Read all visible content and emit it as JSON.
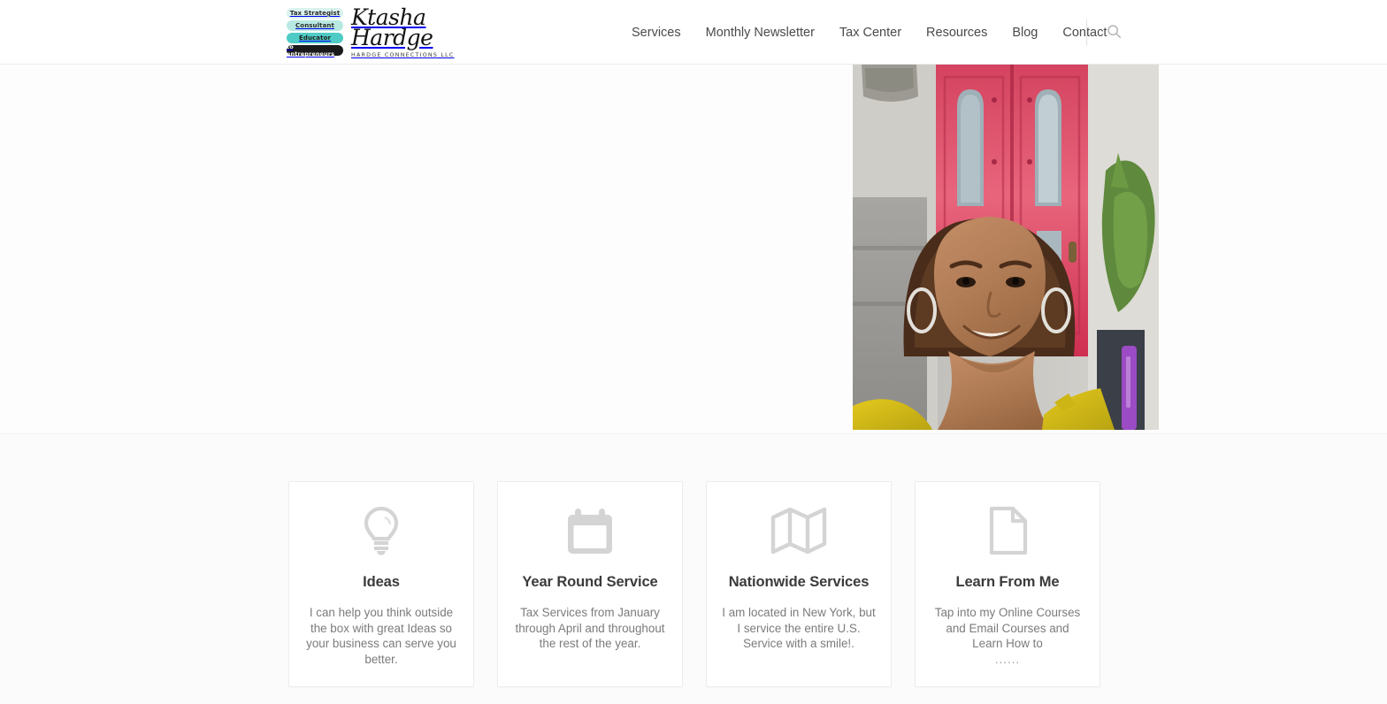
{
  "header": {
    "logo": {
      "badges": [
        "Tax Strategist",
        "Consultant",
        "Educator",
        "to entrepreneurs"
      ],
      "script_line1": "Ktasha",
      "script_line2": "Hardge",
      "subtitle": "HARDGE CONNECTIONS LLC"
    },
    "nav": [
      {
        "label": "Services"
      },
      {
        "label": "Monthly Newsletter"
      },
      {
        "label": "Tax Center"
      },
      {
        "label": "Resources"
      },
      {
        "label": "Blog"
      },
      {
        "label": "Contact"
      }
    ],
    "search_icon": "search-icon"
  },
  "hero": {
    "photo_alt": "Portrait of woman smiling in front of a red door"
  },
  "cards": [
    {
      "icon": "lightbulb-icon",
      "title": "Ideas",
      "text": "I can help you think outside the box with great Ideas so your business can serve you better.",
      "ellipsis": ""
    },
    {
      "icon": "calendar-icon",
      "title": "Year Round Service",
      "text": "Tax Services from January through April and throughout the rest of the year.",
      "ellipsis": ""
    },
    {
      "icon": "map-icon",
      "title": "Nationwide Services",
      "text": "I am located in New York, but I service the entire U.S. Service with a smile!.",
      "ellipsis": ""
    },
    {
      "icon": "document-icon",
      "title": "Learn From Me",
      "text": "Tap into my Online Courses and Email Courses and Learn How to",
      "ellipsis": "......"
    }
  ],
  "colors": {
    "badge_light": "#d9f2ee",
    "badge_mid": "#b7e9e2",
    "badge_teal": "#4ecbc4",
    "badge_dark": "#1a1a1a",
    "nav_text": "#4a4a4a",
    "card_title": "#3b3b3b",
    "card_text": "#7b7b7b",
    "icon_gray": "#d4d4d4",
    "page_bg": "#fbfbfb"
  }
}
